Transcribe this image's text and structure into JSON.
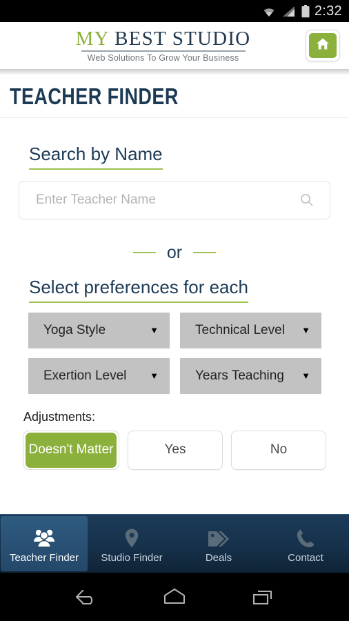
{
  "statusbar": {
    "time": "2:32",
    "icons": [
      "wifi-icon",
      "cellular-signal-icon",
      "battery-icon"
    ]
  },
  "header": {
    "logo_my": "MY",
    "logo_rest": " BEST STUDIO",
    "logo_tagline": "Web Solutions To Grow Your Business",
    "home_button_icon": "home-icon"
  },
  "page": {
    "title": "TEACHER FINDER"
  },
  "search": {
    "heading": "Search by Name",
    "placeholder": "Enter Teacher Name",
    "value": "",
    "icon": "search-icon"
  },
  "divider": {
    "label": "or"
  },
  "preferences": {
    "heading": "Select preferences for each",
    "dropdowns": [
      {
        "label": "Yoga Style",
        "arrow": "▼"
      },
      {
        "label": "Technical Level",
        "arrow": "▼"
      },
      {
        "label": "Exertion Level",
        "arrow": "▼"
      },
      {
        "label": "Years Teaching",
        "arrow": "▼"
      }
    ]
  },
  "adjustments": {
    "label": "Adjustments:",
    "options": [
      {
        "label": "Doesn't Matter",
        "selected": true
      },
      {
        "label": "Yes",
        "selected": false
      },
      {
        "label": "No",
        "selected": false
      }
    ]
  },
  "bottom_nav": {
    "items": [
      {
        "label": "Teacher Finder",
        "icon": "people-group-icon",
        "active": true
      },
      {
        "label": "Studio Finder",
        "icon": "map-pin-icon",
        "active": false
      },
      {
        "label": "Deals",
        "icon": "price-tag-icon",
        "active": false
      },
      {
        "label": "Contact",
        "icon": "phone-icon",
        "active": false
      }
    ]
  },
  "android_nav": {
    "buttons": [
      "back-icon",
      "home-icon",
      "recents-icon"
    ]
  },
  "colors": {
    "brand_green": "#8CB03C",
    "brand_navy": "#1d3a55",
    "accent_rule_green": "#9ec24f",
    "nav_dark": "#16314b",
    "dropdown_gray": "#c2c2c2"
  }
}
